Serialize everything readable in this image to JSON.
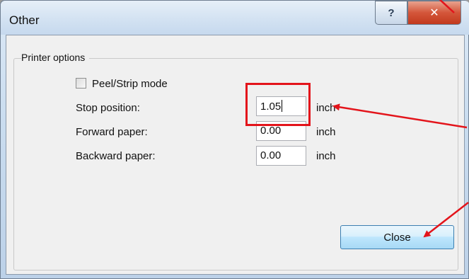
{
  "window": {
    "title": "Other",
    "help_glyph": "?",
    "close_glyph": "✕"
  },
  "group": {
    "label": "Printer options"
  },
  "peel_strip": {
    "label": "Peel/Strip mode",
    "checked": false
  },
  "fields": [
    {
      "label": "Stop position:",
      "value": "1.05",
      "unit": "inch"
    },
    {
      "label": "Forward paper:",
      "value": "0.00",
      "unit": "inch"
    },
    {
      "label": "Backward paper:",
      "value": "0.00",
      "unit": "inch"
    }
  ],
  "buttons": {
    "close_label": "Close"
  },
  "annotation": {
    "color": "#e3141b"
  }
}
